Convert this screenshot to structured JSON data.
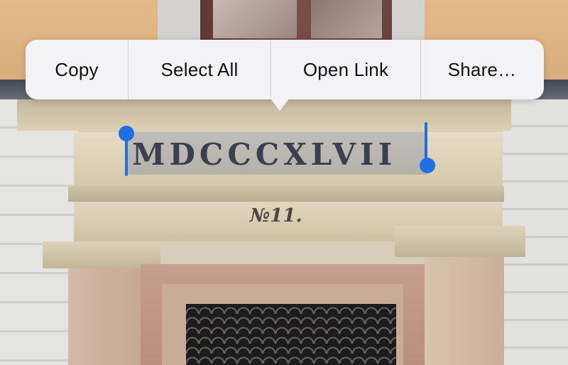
{
  "context_menu": {
    "items": [
      {
        "label": "Copy"
      },
      {
        "label": "Select All"
      },
      {
        "label": "Open Link"
      },
      {
        "label": "Share…"
      }
    ]
  },
  "photo": {
    "inscription": "MDCCCXLVII",
    "house_number": "№11."
  },
  "colors": {
    "selection_handle": "#1f6fe5",
    "menu_background": "#f3f3f5",
    "menu_text": "#111111",
    "selection_highlight": "#5a6e96"
  },
  "icons": {
    "selection_start": "selection-start-handle-icon",
    "selection_end": "selection-end-handle-icon"
  }
}
